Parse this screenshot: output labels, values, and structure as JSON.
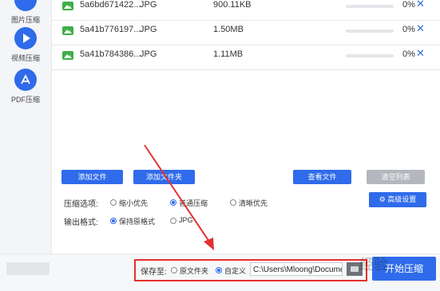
{
  "sidebar": {
    "items": [
      {
        "label": "图片压缩",
        "icon": "image-compress-icon"
      },
      {
        "label": "视频压缩",
        "icon": "play-icon"
      },
      {
        "label": "PDF压缩",
        "icon": "pdf-icon"
      }
    ]
  },
  "files": [
    {
      "name": "5a6bd671422...",
      "type": "JPG",
      "size": "900.11KB",
      "percent": "0%",
      "progress": 0
    },
    {
      "name": "5a41b776197...",
      "type": "JPG",
      "size": "1.50MB",
      "percent": "0%",
      "progress": 0
    },
    {
      "name": "5a41b784386...",
      "type": "JPG",
      "size": "1.11MB",
      "percent": "0%",
      "progress": 0
    }
  ],
  "buttons": {
    "add_file": "添加文件",
    "add_folder": "添加文件夹",
    "view_file": "查看文件",
    "clear_list": "清空列表",
    "advanced": "高级设置",
    "start": "开始压缩"
  },
  "options": {
    "compress_label": "压缩选项:",
    "compress_choices": [
      "缩小优先",
      "普通压缩",
      "清晰优先"
    ],
    "compress_selected": 1,
    "format_label": "输出格式:",
    "format_choices": [
      "保持原格式",
      "JPG"
    ],
    "format_selected": 0
  },
  "save": {
    "label": "保存至:",
    "choices": [
      "原文件夹",
      "自定义"
    ],
    "selected": 1,
    "path": "C:\\Users\\Mloong\\Docume"
  },
  "watermark": "经验",
  "colors": {
    "accent": "#2f6bea",
    "highlight": "#e63030",
    "icon_green": "#3fae4a"
  }
}
